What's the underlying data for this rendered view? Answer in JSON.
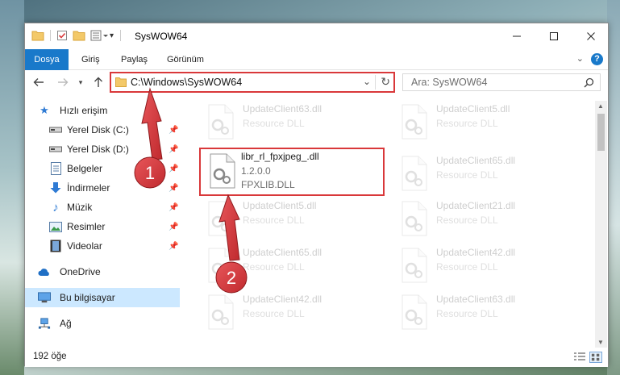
{
  "window": {
    "title": "SysWOW64",
    "controls": [
      "minimize-icon",
      "maximize-icon",
      "close-icon"
    ]
  },
  "ribbon": {
    "tabs": [
      "Dosya",
      "Giriş",
      "Paylaş",
      "Görünüm"
    ],
    "help": "?"
  },
  "nav": {
    "address": "C:\\Windows\\SysWOW64",
    "search_placeholder": "Ara: SysWOW64"
  },
  "sidebar": {
    "items": [
      {
        "label": "Hızlı erişim",
        "icon": "star-icon",
        "pinned": false
      },
      {
        "label": "Yerel Disk (C:)",
        "icon": "drive-icon",
        "pinned": true
      },
      {
        "label": "Yerel Disk (D:)",
        "icon": "drive-icon",
        "pinned": true
      },
      {
        "label": "Belgeler",
        "icon": "documents-icon",
        "pinned": true
      },
      {
        "label": "İndirmeler",
        "icon": "download-icon",
        "pinned": true
      },
      {
        "label": "Müzik",
        "icon": "music-icon",
        "pinned": true
      },
      {
        "label": "Resimler",
        "icon": "pictures-icon",
        "pinned": true
      },
      {
        "label": "Videolar",
        "icon": "video-icon",
        "pinned": true
      },
      {
        "label": "OneDrive",
        "icon": "cloud-icon",
        "pinned": false
      },
      {
        "label": "Bu bilgisayar",
        "icon": "computer-icon",
        "pinned": false,
        "selected": true
      },
      {
        "label": "Ağ",
        "icon": "network-icon",
        "pinned": false
      }
    ]
  },
  "files": [
    {
      "name": "UpdateClient63.dll",
      "line2": "Resource DLL",
      "faded": true
    },
    {
      "name": "UpdateClient5.dll",
      "line2": "Resource DLL",
      "faded": true
    },
    {
      "name": "libr_rl_fpxjpeg_.dll",
      "line2": "1.2.0.0",
      "line3": "FPXLIB.DLL",
      "highlight": true
    },
    {
      "name": "UpdateClient65.dll",
      "line2": "Resource DLL",
      "faded": true
    },
    {
      "name": "UpdateClient5.dll",
      "line2": "Resource DLL",
      "faded": true
    },
    {
      "name": "UpdateClient21.dll",
      "line2": "Resource DLL",
      "faded": true
    },
    {
      "name": "UpdateClient65.dll",
      "line2": "Resource DLL",
      "faded": true
    },
    {
      "name": "UpdateClient42.dll",
      "line2": "Resource DLL",
      "faded": true
    },
    {
      "name": "UpdateClient42.dll",
      "line2": "Resource DLL",
      "faded": true
    },
    {
      "name": "UpdateClient63.dll",
      "line2": "Resource DLL",
      "faded": true
    }
  ],
  "status": {
    "count": "192 öğe"
  },
  "annotations": {
    "step1": "1",
    "step2": "2",
    "color": "#d9383a"
  },
  "colors": {
    "accent": "#1979ca",
    "selection": "#cce8ff",
    "highlight_border": "#d9383a"
  }
}
